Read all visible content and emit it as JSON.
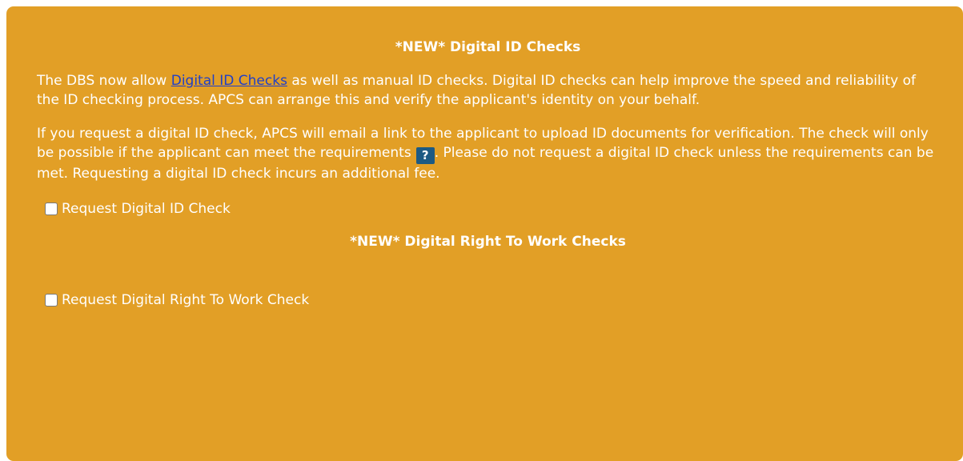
{
  "digital_id": {
    "heading": "*NEW* Digital ID Checks",
    "para1_before_link": "The DBS now allow ",
    "para1_link": "Digital ID Checks",
    "para1_after_link": " as well as manual ID checks. Digital ID checks can help improve the speed and reliability of the ID checking process. APCS can arrange this and verify the applicant's identity on your behalf.",
    "para2_before_help": "If you request a digital ID check, APCS will email a link to the applicant to upload ID documents for verification. The check will only be possible if the applicant can meet the requirements",
    "help_icon_glyph": "?",
    "para2_after_help": ". Please do not request a digital ID check unless the requirements can be met. Requesting a digital ID check incurs an additional fee.",
    "checkbox_label": "Request Digital ID Check",
    "checkbox_checked": false
  },
  "right_to_work": {
    "heading": "*NEW* Digital Right To Work Checks",
    "checkbox_label": "Request Digital Right To Work Check",
    "checkbox_checked": false
  },
  "colors": {
    "panel_background": "#e29f26",
    "text": "#ffffff",
    "link": "#1f3fc9",
    "help_badge": "#1d5a83"
  }
}
